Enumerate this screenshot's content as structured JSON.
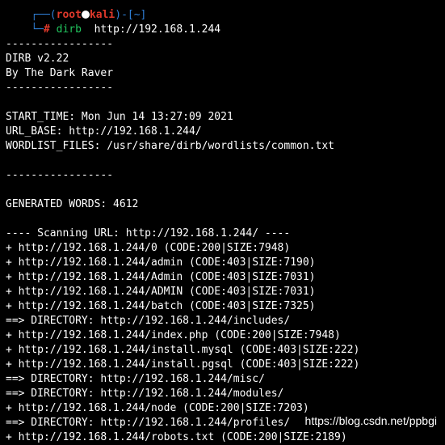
{
  "prompt": {
    "top_prefix": "┌──(",
    "user": "root",
    "host": "kali",
    "top_suffix": ")-[~]",
    "bot_prefix": "└─",
    "hash": "#",
    "command": "dirb",
    "argument": "http://192.168.1.244"
  },
  "output": {
    "sep1": "-----------------",
    "version": "DIRB v2.22",
    "author": "By The Dark Raver",
    "sep2": "-----------------",
    "start_time": "START_TIME: Mon Jun 14 13:27:09 2021",
    "url_base": "URL_BASE: http://192.168.1.244/",
    "wordlist": "WORDLIST_FILES: /usr/share/dirb/wordlists/common.txt",
    "sep3": "-----------------",
    "generated": "GENERATED WORDS: 4612",
    "scanning": "---- Scanning URL: http://192.168.1.244/ ----",
    "results": [
      "+ http://192.168.1.244/0 (CODE:200|SIZE:7948)",
      "+ http://192.168.1.244/admin (CODE:403|SIZE:7190)",
      "+ http://192.168.1.244/Admin (CODE:403|SIZE:7031)",
      "+ http://192.168.1.244/ADMIN (CODE:403|SIZE:7031)",
      "+ http://192.168.1.244/batch (CODE:403|SIZE:7325)",
      "==> DIRECTORY: http://192.168.1.244/includes/",
      "+ http://192.168.1.244/index.php (CODE:200|SIZE:7948)",
      "+ http://192.168.1.244/install.mysql (CODE:403|SIZE:222)",
      "+ http://192.168.1.244/install.pgsql (CODE:403|SIZE:222)",
      "==> DIRECTORY: http://192.168.1.244/misc/",
      "==> DIRECTORY: http://192.168.1.244/modules/",
      "+ http://192.168.1.244/node (CODE:200|SIZE:7203)",
      "==> DIRECTORY: http://192.168.1.244/profiles/",
      "+ http://192.168.1.244/robots.txt (CODE:200|SIZE:2189)"
    ]
  },
  "watermark": "https://blog.csdn.net/ppbgi",
  "colors": {
    "background": "#000000",
    "text": "#ffffff",
    "prompt_frame": "#2f7fd6",
    "prompt_user": "#e0392b",
    "command": "#22c55e"
  }
}
